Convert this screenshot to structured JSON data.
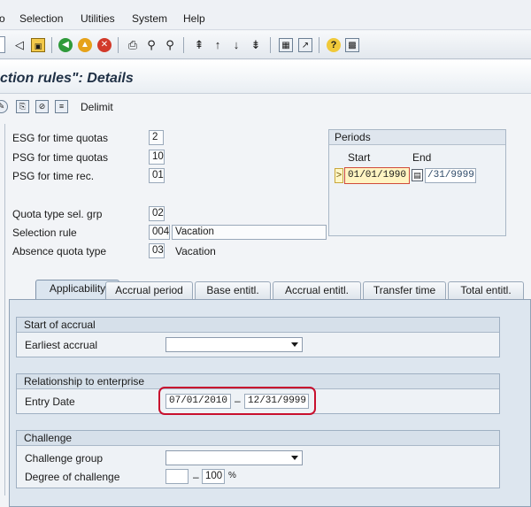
{
  "menu": {
    "items": [
      "Selection",
      "Utilities",
      "System",
      "Help"
    ],
    "cut_item": "o"
  },
  "title": "ction rules\": Details",
  "app_toolbar": {
    "delimit_label": "Delimit"
  },
  "fields": {
    "esg_label": "ESG for time quotas",
    "esg_value": "2",
    "psg_quotas_label": "PSG for time quotas",
    "psg_quotas_value": "10",
    "psg_rec_label": "PSG for time rec.",
    "psg_rec_value": "01",
    "quota_grp_label": "Quota type sel. grp",
    "quota_grp_value": "02",
    "selection_rule_label": "Selection rule",
    "selection_rule_value": "004",
    "selection_rule_text": "Vacation",
    "absence_label": "Absence quota type",
    "absence_value": "03",
    "absence_text": "Vacation"
  },
  "periods": {
    "header": "Periods",
    "start_label": "Start",
    "end_label": "End",
    "start_value": "01/01/1990",
    "end_value": "/31/9999",
    "marker": ">"
  },
  "tabs": [
    "Applicability",
    "Accrual period",
    "Base entitl.",
    "Accrual entitl.",
    "Transfer time",
    "Total entitl."
  ],
  "groups": {
    "start_accrual": {
      "header": "Start of accrual",
      "earliest_label": "Earliest accrual"
    },
    "relationship": {
      "header": "Relationship to enterprise",
      "entry_label": "Entry Date",
      "entry_from": "07/01/2010",
      "entry_dash": "–",
      "entry_to": "12/31/9999"
    },
    "challenge": {
      "header": "Challenge",
      "group_label": "Challenge group",
      "degree_label": "Degree of challenge",
      "degree_dash": "–",
      "degree_to": "100",
      "degree_unit": "%"
    }
  },
  "colors": {
    "highlight": "#c8102e",
    "required_field": "#fff4c2"
  }
}
